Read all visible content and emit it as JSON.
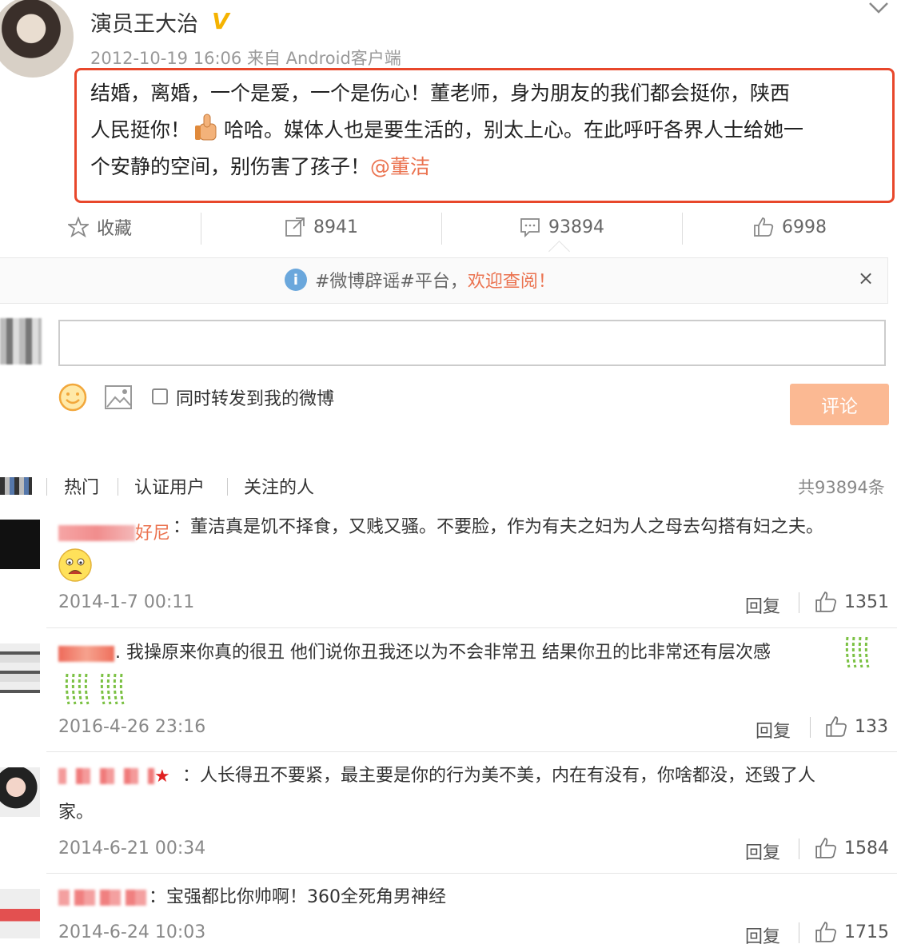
{
  "post": {
    "author": "演员王大治",
    "verified_icon": "V",
    "timestamp": "2012-10-19 16:06",
    "source": "来自 Android客户端",
    "text_line1": "结婚，离婚，一个是爱，一个是伤心！董老师，身为朋友的我们都会挺你，陕西",
    "text_line2a": "人民挺你！",
    "text_line2b": "哈哈。媒体人也是要生活的，别太上心。在此呼吁各界人士给她一",
    "text_line3": "个安静的空间，别伤害了孩子！",
    "mention": "@董洁"
  },
  "actions": {
    "favorite_label": "收藏",
    "repost_count": "8941",
    "comment_count": "93894",
    "like_count": "6998",
    "icons": [
      "star-icon",
      "repost-icon",
      "comment-icon",
      "thumbs-up-icon"
    ]
  },
  "rumor_bar": {
    "text": "#微博辟谣#平台，",
    "link": "欢迎查阅！",
    "close": "×"
  },
  "composer": {
    "input_value": "",
    "checkbox_label": "同时转发到我的微博",
    "submit_label": "评论"
  },
  "filters": {
    "tabs": [
      "热门",
      "认证用户",
      "关注的人"
    ],
    "total": "共93894条"
  },
  "colors": {
    "accent": "#eb7350",
    "highlight_border": "#e8472b",
    "submit_bg": "#fbb993",
    "verified": "#f5b301"
  },
  "comments": [
    {
      "user_visible": "好尼",
      "text": "：董洁真是饥不择食，又贱又骚。不要脸，作为有夫之妇为人之母去勾搭有妇之夫。",
      "time": "2014-1-7 00:11",
      "reply": "回复",
      "likes": "1351"
    },
    {
      "user_visible": "",
      "text": ". 我操原来你真的很丑 他们说你丑我还以为不会非常丑 结果你丑的比非常还有层次感",
      "time": "2016-4-26 23:16",
      "reply": "回复",
      "likes": "133"
    },
    {
      "user_visible": "★",
      "text": "：人长得丑不要紧，最主要是你的行为美不美，内在有没有，你啥都没，还毁了人",
      "text_line2": "家。",
      "time": "2014-6-21 00:34",
      "reply": "回复",
      "likes": "1584"
    },
    {
      "user_visible": "",
      "text": "：宝强都比你帅啊！360全死角男神经",
      "time": "2014-6-24 10:03",
      "reply": "回复",
      "likes": "1715"
    }
  ]
}
